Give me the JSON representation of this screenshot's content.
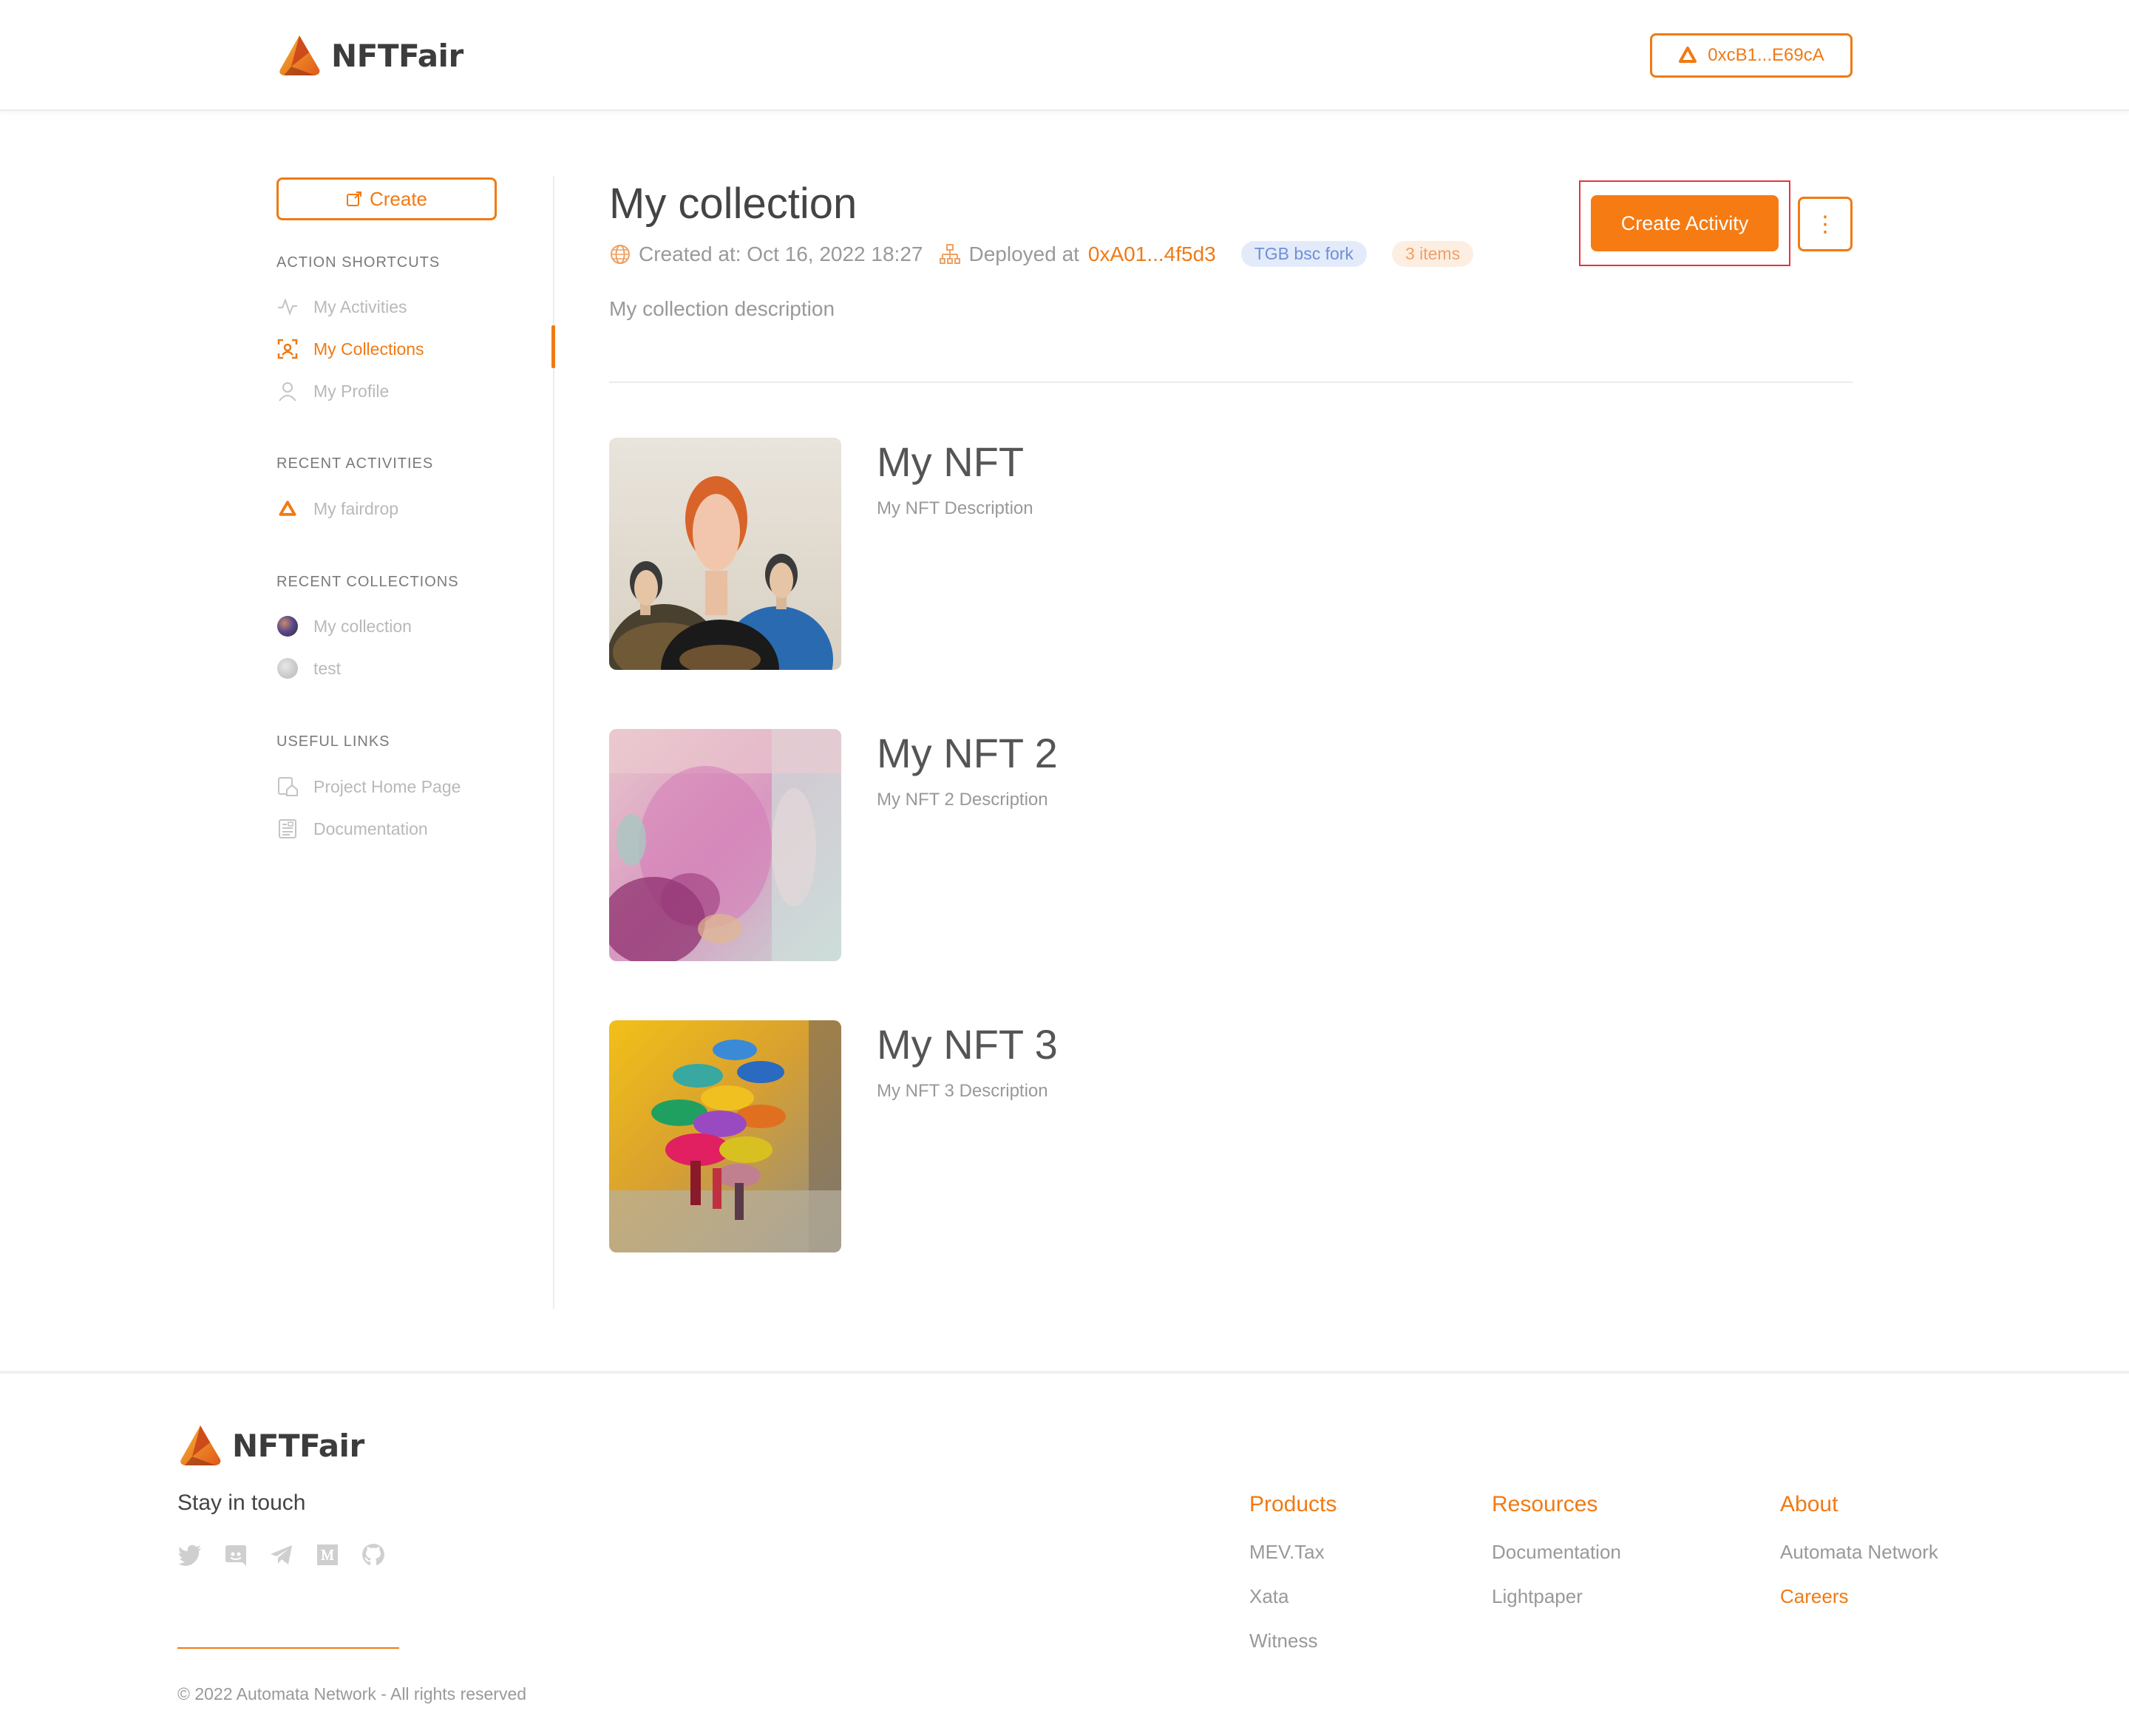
{
  "header": {
    "brand": "NFTFair",
    "wallet_address": "0xcB1...E69cA"
  },
  "sidebar": {
    "create_label": "Create",
    "sections": {
      "action_shortcuts": "ACTION SHORTCUTS",
      "recent_activities": "RECENT ACTIVITIES",
      "recent_collections": "RECENT COLLECTIONS",
      "useful_links": "USEFUL LINKS"
    },
    "items": {
      "my_activities": "My Activities",
      "my_collections": "My Collections",
      "my_profile": "My Profile",
      "my_fairdrop": "My fairdrop",
      "my_collection": "My collection",
      "test": "test",
      "project_home_page": "Project Home Page",
      "documentation": "Documentation"
    }
  },
  "collection": {
    "title": "My collection",
    "created_label": "Created at: Oct 16, 2022 18:27",
    "deployed_label": "Deployed at",
    "deployed_address": "0xA01...4f5d3",
    "network_badge": "TGB bsc fork",
    "items_badge": "3 items",
    "description": "My collection description",
    "create_activity_label": "Create Activity",
    "more_label": "⋮"
  },
  "nfts": [
    {
      "name": "My NFT",
      "description": "My NFT Description"
    },
    {
      "name": "My NFT 2",
      "description": "My NFT 2 Description"
    },
    {
      "name": "My NFT 3",
      "description": "My NFT 3 Description"
    }
  ],
  "footer": {
    "brand": "NFTFair",
    "stay_in_touch": "Stay in touch",
    "copyright": "© 2022 Automata Network - All rights reserved",
    "columns": [
      {
        "heading": "Products",
        "links": [
          "MEV.Tax",
          "Xata",
          "Witness"
        ]
      },
      {
        "heading": "Resources",
        "links": [
          "Documentation",
          "Lightpaper"
        ]
      },
      {
        "heading": "About",
        "links": [
          "Automata Network",
          "Careers"
        ]
      }
    ]
  },
  "colors": {
    "accent": "#f07a14",
    "highlight": "#e8333f",
    "badge_blue": "#e3ebfb",
    "badge_orange": "#fdeee2"
  },
  "icons": [
    "nftfair-logo-icon",
    "automata-icon",
    "create-icon",
    "activity-icon",
    "collections-icon",
    "profile-icon",
    "globe-icon",
    "hierarchy-icon",
    "home-page-icon",
    "document-icon",
    "twitter-icon",
    "discord-icon",
    "telegram-icon",
    "medium-icon",
    "github-icon"
  ]
}
